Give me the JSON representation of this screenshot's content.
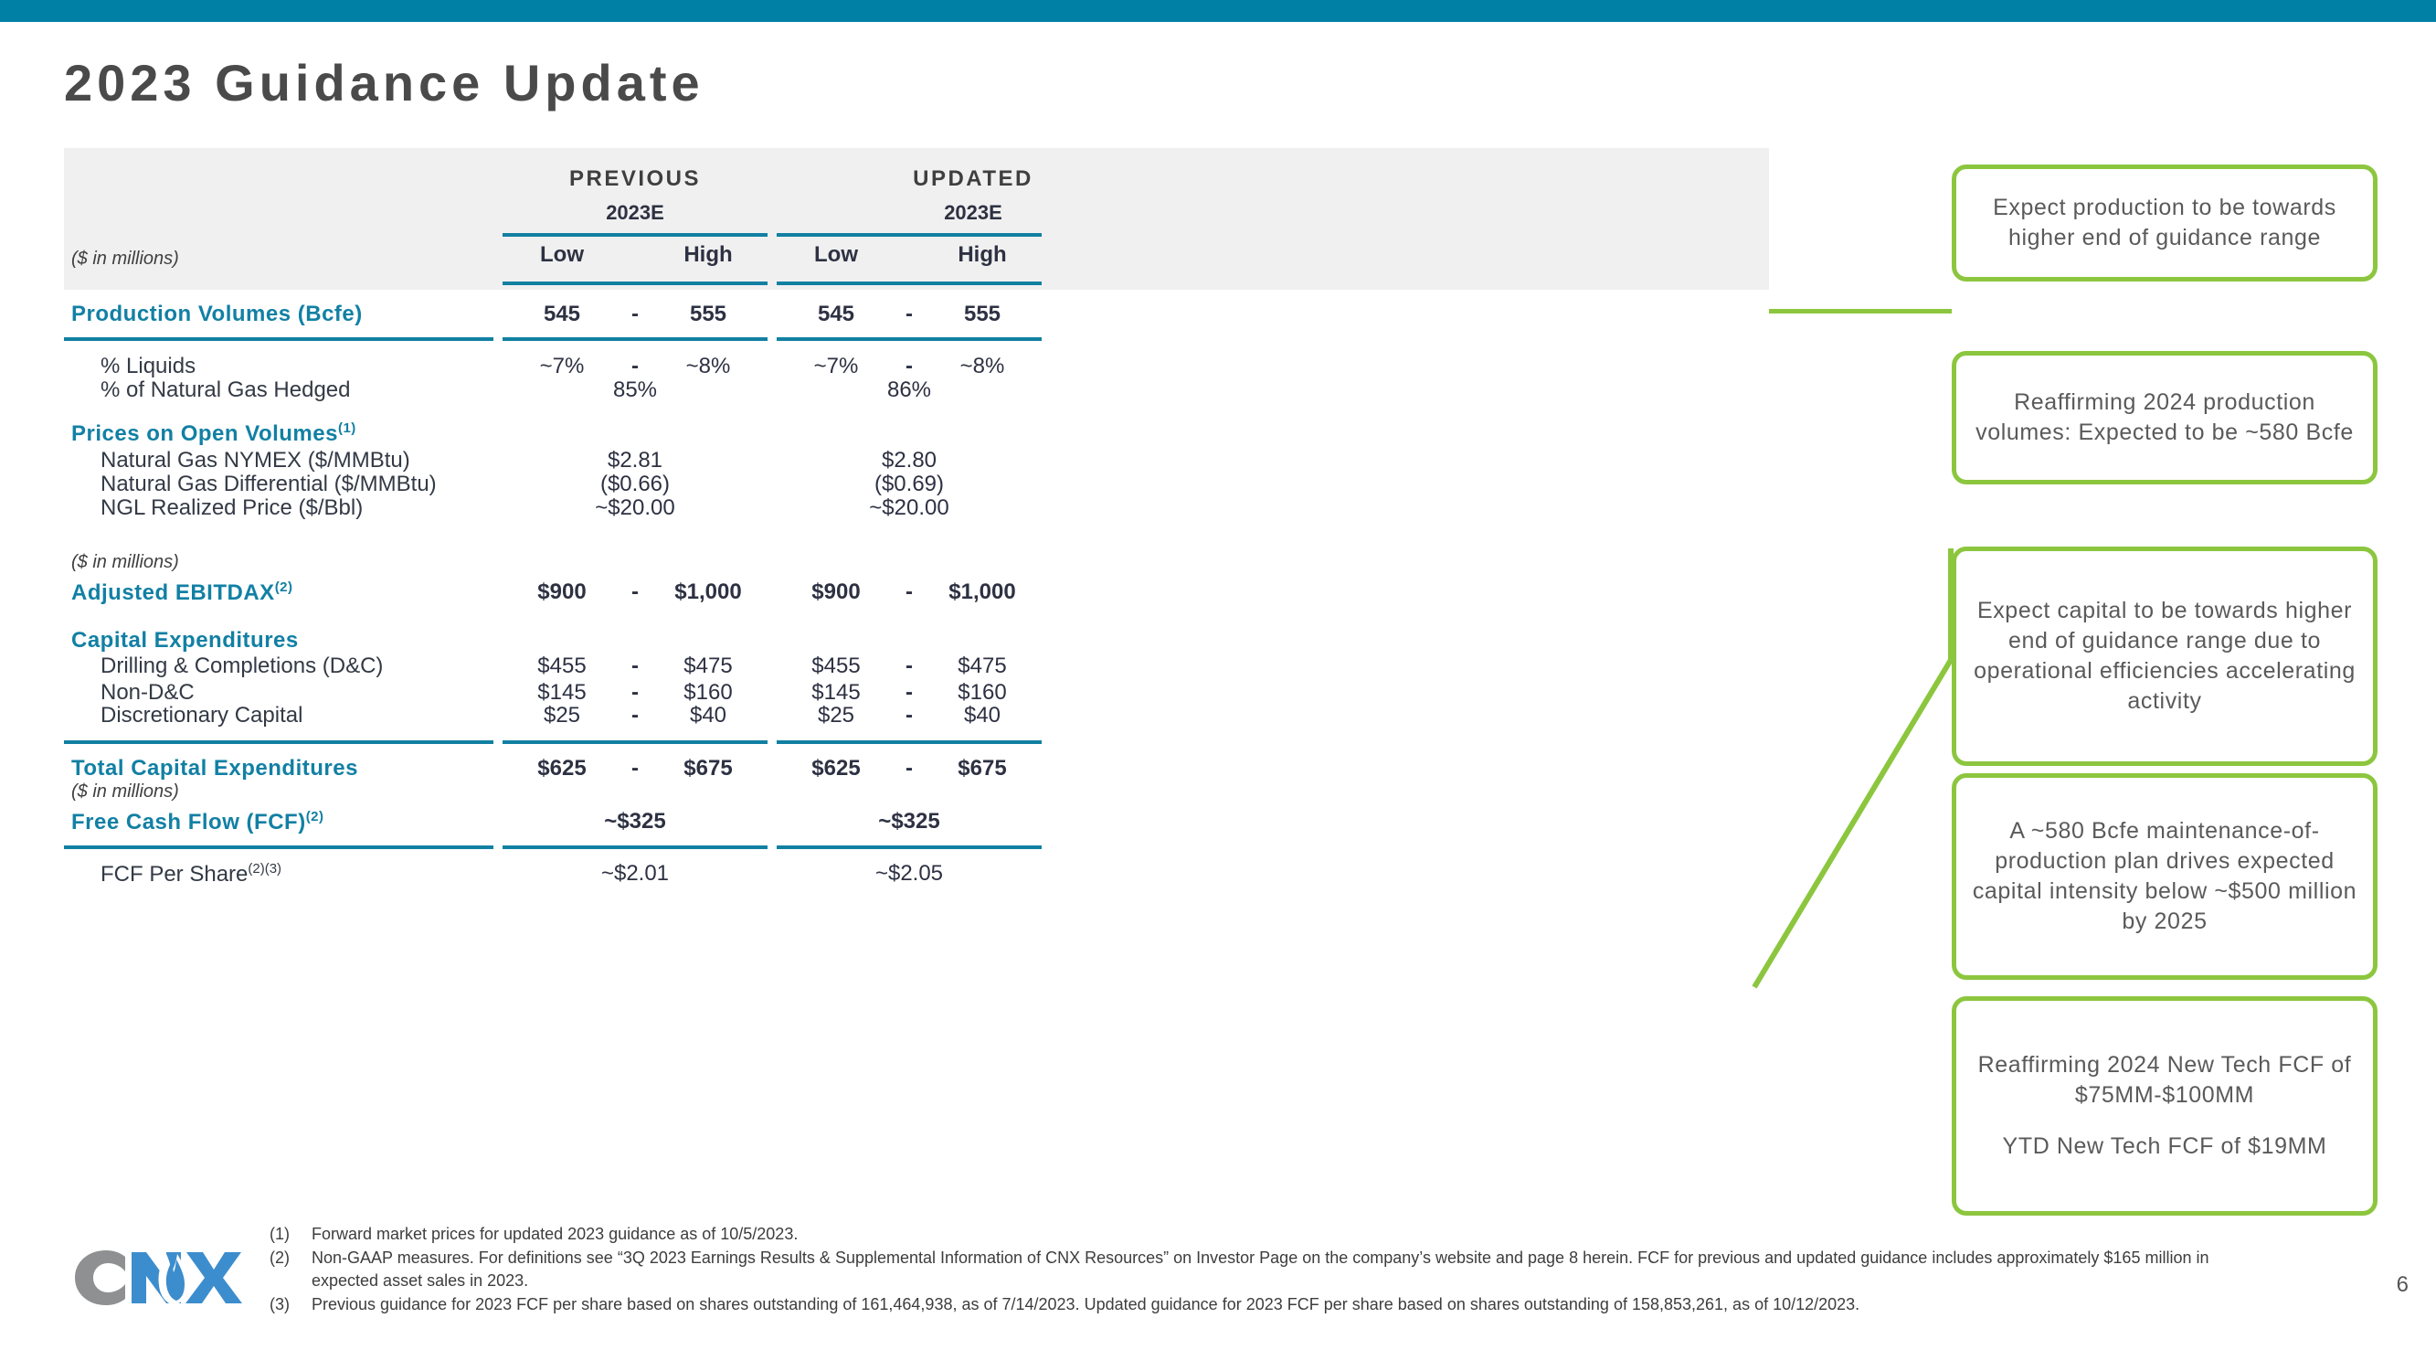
{
  "brand": {
    "accent_teal": "#0180a6",
    "rule_teal": "#1180a2",
    "label_teal": "#1280a4",
    "callout_green": "#8cc63e",
    "logo_gray": "#8e9091",
    "logo_blue": "#3c8dcd",
    "logo_text": "CNX"
  },
  "page_title": "2023 Guidance Update",
  "page_number": "6",
  "table": {
    "groups": [
      {
        "label": "PREVIOUS",
        "year": "2023E"
      },
      {
        "label": "UPDATED",
        "year": "2023E"
      }
    ],
    "column_headers": [
      "Low",
      "High",
      "Low",
      "High"
    ],
    "units_labels": [
      "($ in millions)",
      "($ in millions)",
      "($ in millions)"
    ],
    "rows": [
      {
        "label": "Production Volumes (Bcfe)",
        "prev_low": "545",
        "prev_high": "555",
        "upd_low": "545",
        "upd_high": "555",
        "dash": "-"
      },
      {
        "label": "% Liquids",
        "prev_low": "~7%",
        "prev_high": "~8%",
        "upd_low": "~7%",
        "upd_high": "~8%",
        "dash": "-"
      },
      {
        "label": "% of Natural Gas Hedged",
        "prev_span": "85%",
        "upd_span": "86%"
      },
      {
        "label": "Prices on Open Volumes",
        "sup": "(1)"
      },
      {
        "label": "Natural Gas NYMEX ($/MMBtu)",
        "prev_span": "$2.81",
        "upd_span": "$2.80"
      },
      {
        "label": "Natural Gas Differential ($/MMBtu)",
        "prev_span": "($0.66)",
        "upd_span": "($0.69)"
      },
      {
        "label": "NGL Realized Price ($/Bbl)",
        "prev_span": "~$20.00",
        "upd_span": "~$20.00"
      },
      {
        "label": "Adjusted EBITDAX",
        "sup": "(2)",
        "prev_low": "$900",
        "prev_high": "$1,000",
        "upd_low": "$900",
        "upd_high": "$1,000",
        "dash": "-"
      },
      {
        "label": "Capital Expenditures"
      },
      {
        "label": "Drilling & Completions (D&C)",
        "prev_low": "$455",
        "prev_high": "$475",
        "upd_low": "$455",
        "upd_high": "$475",
        "dash": "-"
      },
      {
        "label": "Non-D&C",
        "prev_low": "$145",
        "prev_high": "$160",
        "upd_low": "$145",
        "upd_high": "$160",
        "dash": "-"
      },
      {
        "label": "Discretionary Capital",
        "prev_low": "$25",
        "prev_high": "$40",
        "upd_low": "$25",
        "upd_high": "$40",
        "dash": "-"
      },
      {
        "label": "Total Capital Expenditures",
        "prev_low": "$625",
        "prev_high": "$675",
        "upd_low": "$625",
        "upd_high": "$675",
        "dash": "-"
      },
      {
        "label": "Free Cash Flow (FCF)",
        "sup": "(2)",
        "prev_span": "~$325",
        "upd_span": "~$325"
      },
      {
        "label": "FCF Per Share",
        "sup": "(2)(3)",
        "prev_span": "~$2.01",
        "upd_span": "~$2.05"
      }
    ]
  },
  "callouts": [
    {
      "lines": [
        "Expect production to be towards higher end of guidance range"
      ]
    },
    {
      "lines": [
        "Reaffirming 2024 production volumes: Expected to be ~580 Bcfe"
      ]
    },
    {
      "lines": [
        "Expect capital to be towards higher end of guidance range due to operational efficiencies accelerating activity"
      ]
    },
    {
      "lines": [
        "A ~580 Bcfe maintenance-of-production plan drives expected capital intensity below ~$500 million by 2025"
      ]
    },
    {
      "lines": [
        "Reaffirming 2024 New Tech FCF of $75MM-$100MM",
        "YTD New Tech FCF of $19MM"
      ]
    }
  ],
  "footnotes": [
    {
      "num": "(1)",
      "text": "Forward market prices for updated 2023 guidance as of 10/5/2023."
    },
    {
      "num": "(2)",
      "text": "Non-GAAP measures. For definitions see “3Q 2023 Earnings Results & Supplemental Information of CNX Resources” on Investor Page on the company’s website and page 8 herein. FCF for previous and updated guidance includes approximately $165 million in expected asset sales in 2023."
    },
    {
      "num": "(3)",
      "text": "Previous guidance for 2023 FCF per share based on shares outstanding of 161,464,938, as of 7/14/2023. Updated guidance for 2023 FCF per share based on shares outstanding of 158,853,261, as of 10/12/2023."
    }
  ]
}
